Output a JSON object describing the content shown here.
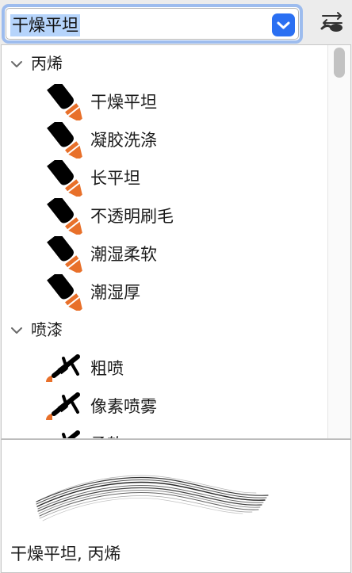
{
  "brush_selector": {
    "selected_value": "干燥平坦",
    "dropdown_icon": "chevron-down-icon",
    "swap_icon": "swap-arrows-icon"
  },
  "brush_list": {
    "groups": [
      {
        "name": "丙烯",
        "expanded": true,
        "icon": "paintbrush-icon",
        "items": [
          "干燥平坦",
          "凝胶洗涤",
          "长平坦",
          "不透明刷毛",
          "潮湿柔软",
          "潮湿厚"
        ]
      },
      {
        "name": "喷漆",
        "expanded": true,
        "icon": "airbrush-icon",
        "items": [
          "粗喷",
          "像素喷雾",
          "柔软"
        ]
      }
    ]
  },
  "preview": {
    "caption": "干燥平坦, 丙烯"
  },
  "colors": {
    "accent": "#2a6ff2",
    "focus_ring": "#9dbcee",
    "selection": "#b6d4fb",
    "brush_orange": "#e8702a"
  }
}
